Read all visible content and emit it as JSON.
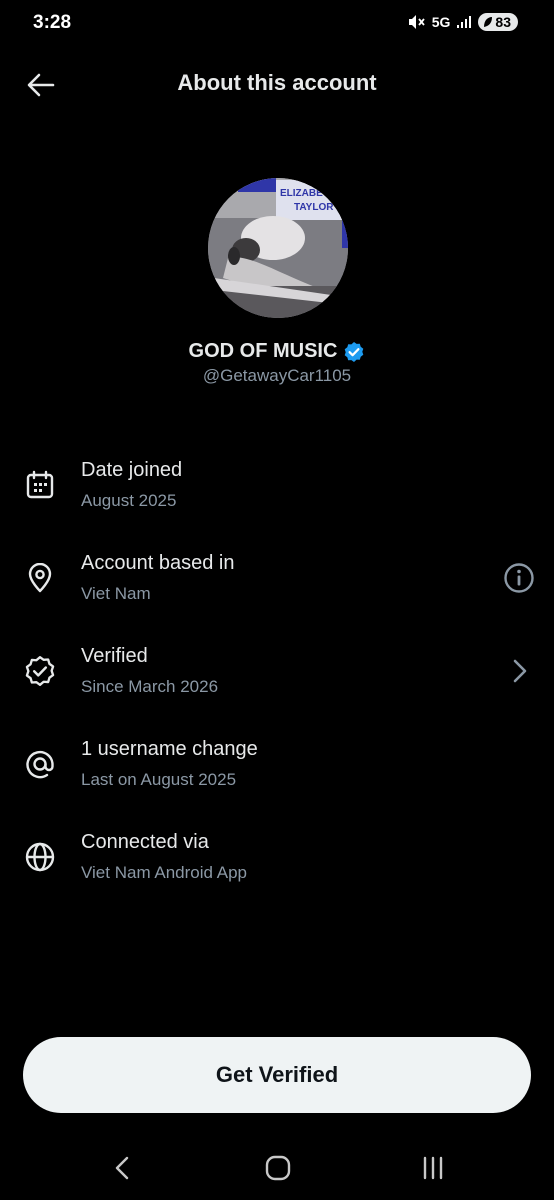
{
  "status_bar": {
    "time": "3:28",
    "network": "5G",
    "battery": "83"
  },
  "header": {
    "title": "About this account"
  },
  "profile": {
    "display_name": "GOD OF MUSIC",
    "handle": "@GetawayCar1105",
    "verified": true,
    "avatar_text_line1": "ELIZABETH",
    "avatar_text_line2": "TAYLOR"
  },
  "info_items": [
    {
      "icon": "calendar-icon",
      "title": "Date joined",
      "subtitle": "August 2025"
    },
    {
      "icon": "location-pin-icon",
      "title": "Account based in",
      "subtitle": "Viet Nam",
      "action": "info-icon"
    },
    {
      "icon": "verified-badge-icon",
      "title": "Verified",
      "subtitle": "Since March 2026",
      "action": "chevron-right-icon"
    },
    {
      "icon": "at-sign-icon",
      "title": "1 username change",
      "subtitle": "Last on August 2025"
    },
    {
      "icon": "globe-icon",
      "title": "Connected via",
      "subtitle": "Viet Nam Android App"
    }
  ],
  "cta": {
    "label": "Get Verified"
  },
  "colors": {
    "background": "#000000",
    "primary_text": "#e7e9ea",
    "secondary_text": "#8b98a5",
    "verified_blue": "#1d9bf0",
    "button_bg": "#eff3f4"
  }
}
